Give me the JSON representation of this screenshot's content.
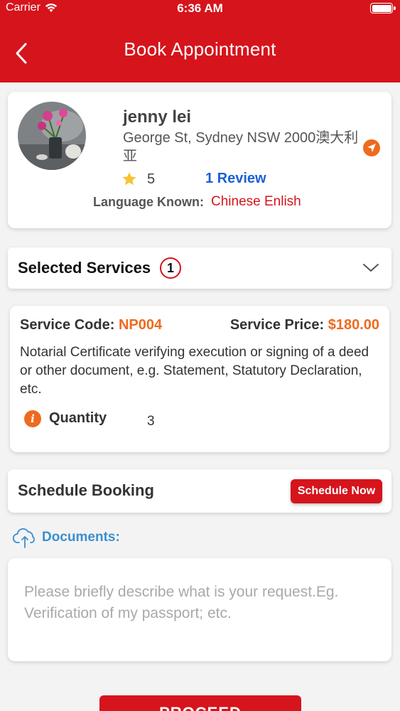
{
  "status_bar": {
    "carrier": "Carrier",
    "time": "6:36 AM"
  },
  "header": {
    "title": "Book Appointment",
    "back_icon": "chevron-left-icon"
  },
  "provider": {
    "name": "jenny lei",
    "address": "George St, Sydney NSW 2000澳大利亚",
    "rating": "5",
    "reviews": "1 Review",
    "language_label": "Language Known:",
    "languages": "Chinese Enlish"
  },
  "services": {
    "title": "Selected Services",
    "count": "1"
  },
  "service_item": {
    "code_label": "Service Code:",
    "code": "NP004",
    "price_label": "Service Price:",
    "price": "$180.00",
    "description": "Notarial Certificate verifying execution or signing of a deed or other document, e.g. Statement, Statutory Declaration, etc.",
    "quantity_label": "Quantity",
    "quantity": "3"
  },
  "schedule": {
    "title": "Schedule Booking",
    "button": "Schedule Now"
  },
  "documents": {
    "label": "Documents:"
  },
  "request": {
    "placeholder": "Please briefly describe what is your request.Eg. Verification of my passport; etc."
  },
  "proceed": {
    "label": "PROCEED"
  },
  "colors": {
    "brand": "#d6141c",
    "accent": "#ee6a1f",
    "link": "#1a5fd6",
    "docs": "#3a8fd0"
  }
}
